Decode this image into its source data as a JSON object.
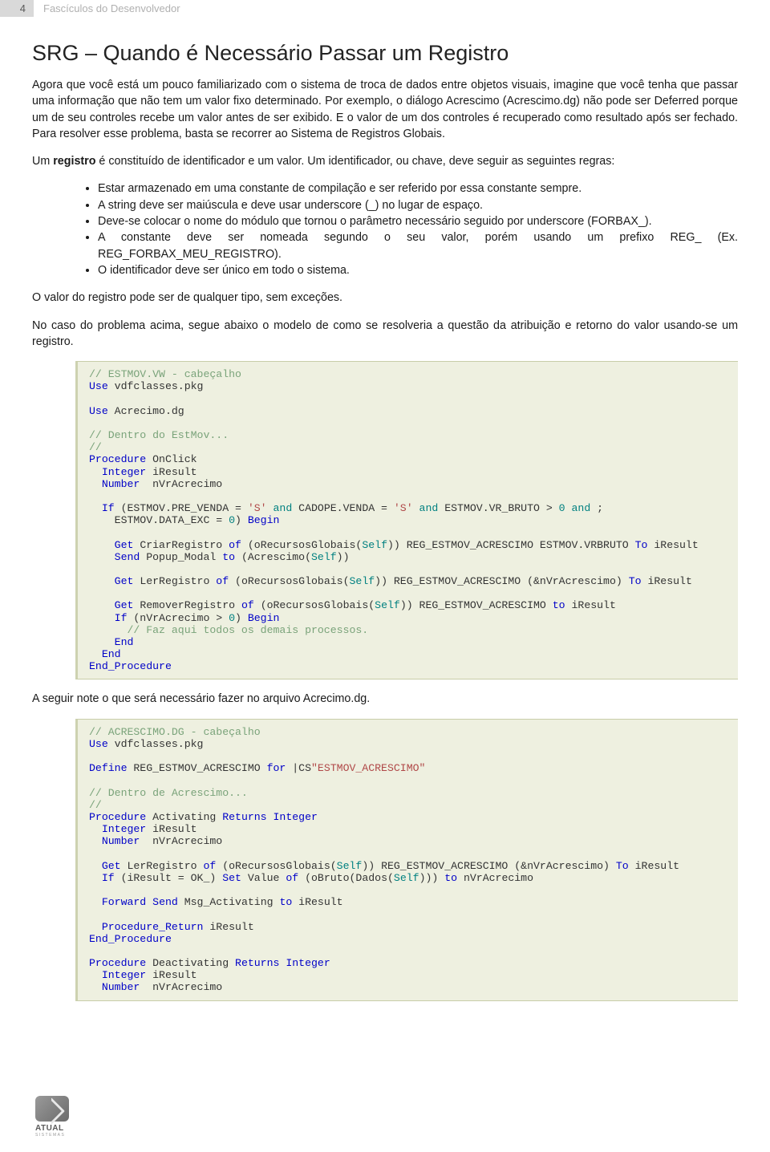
{
  "header": {
    "page_number": "4",
    "section": "Fascículos do Desenvolvedor"
  },
  "title": "SRG – Quando é Necessário Passar um Registro",
  "para1": "Agora que você está um pouco familiarizado com o sistema de troca de dados entre objetos visuais, imagine que você tenha que passar uma informação que não tem um valor fixo determinado. Por exemplo, o diálogo Acrescimo (Acrescimo.dg) não pode ser Deferred porque um de seu controles recebe um valor antes de ser exibido. E o valor de um dos controles é recuperado como resultado após ser fechado. Para resolver esse problema, basta se recorrer ao Sistema de Registros Globais.",
  "para2_pre": "Um ",
  "para2_bold": "registro",
  "para2_post": " é constituído de identificador e um valor. Um identificador, ou chave, deve seguir as seguintes regras:",
  "bullets": [
    "Estar armazenado em uma constante de compilação e ser referido por essa constante sempre.",
    "A string deve ser maiúscula e deve usar underscore (_) no lugar de espaço.",
    "Deve-se colocar o nome do módulo que tornou o parâmetro necessário seguido por underscore (FORBAX_).",
    "A constante deve ser nomeada segundo o seu valor, porém usando um prefixo REG_ (Ex. REG_FORBAX_MEU_REGISTRO).",
    "O identificador deve ser único em todo o sistema."
  ],
  "para3": "O valor do registro pode ser de qualquer tipo, sem exceções.",
  "para4": "No caso do problema acima, segue abaixo o modelo de como se resolveria a questão da atribuição e retorno do valor usando-se um registro.",
  "para5": "A seguir note o que será necessário fazer no arquivo Acrecimo.dg.",
  "code1": {
    "c1": "// ESTMOV.VW - cabeçalho",
    "use": "Use",
    "pkg": " vdfclasses.pkg",
    "dg": " Acrecimo.dg",
    "c2": "// Dentro do EstMov...",
    "c3": "//",
    "proc": "Procedure",
    "onclick": " OnClick",
    "integer": "Integer",
    "iresult": " iResult",
    "number": "Number",
    "nvr": "  nVrAcrecimo",
    "if": "If",
    "cond1": " (ESTMOV.PRE_VENDA = ",
    "s": "'S'",
    "and": " and",
    "cond2": " CADOPE.VENDA = ",
    "cond3": " ESTMOV.VR_BRUTO > ",
    "zero": "0",
    "semi": " ;",
    "cond4": "    ESTMOV.DATA_EXC = ",
    "begin": "Begin",
    "get": "Get",
    "criar": " CriarRegistro ",
    "of": "of",
    "org": " (oRecursosGlobais(",
    "self": "Self",
    "rest1": ")) REG_ESTMOV_ACRESCIMO ESTMOV.VRBRUTO ",
    "to": "To",
    "ir": " iResult",
    "send": "Send",
    "popup": " Popup_Modal ",
    "to2": "to",
    "acr": " (Acrescimo(",
    "close": "))",
    "ler": " LerRegistro ",
    "rest2": ")) REG_ESTMOV_ACRESCIMO (&nVrAcrescimo) ",
    "rem": " RemoverRegistro ",
    "rest3": ")) REG_ESTMOV_ACRESCIMO ",
    "ifnvr": " (nVrAcrecimo > ",
    "cfaz": "// Faz aqui todos os demais processos.",
    "end": "End",
    "endp": "End_Procedure"
  },
  "code2": {
    "c1": "// ACRESCIMO.DG - cabeçalho",
    "define": "Define",
    "reg": " REG_ESTMOV_ACRESCIMO ",
    "for": "for",
    "cs": " |CS",
    "str": "\"ESTMOV_ACRESCIMO\"",
    "c2": "// Dentro de Acrescimo...",
    "c3": "//",
    "act": " Activating ",
    "returns": "Returns",
    "intw": " Integer",
    "ifres": " (iResult = OK_) ",
    "set": "Set",
    "val": " Value ",
    "obruto": " (oBruto(Dados(",
    "close3": "))) ",
    "tonvr": " nVrAcrecimo",
    "fwd": "Forward",
    "msg": " Msg_Activating ",
    "pret": "Procedure_Return",
    "deact": " Deactivating "
  },
  "logo": {
    "brand": "ATUAL",
    "sub": "SISTEMAS"
  }
}
